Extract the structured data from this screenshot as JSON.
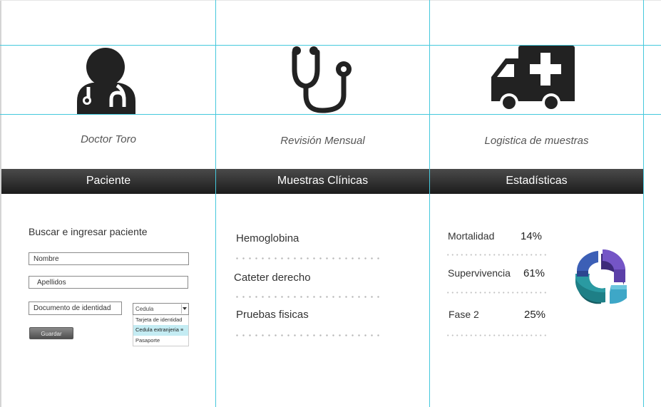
{
  "columns": [
    {
      "caption": "Doctor Toro",
      "header": "Paciente",
      "icon": "doctor-icon",
      "title": "Buscar e ingresar paciente",
      "fields": {
        "nombre_placeholder": "Nombre",
        "apellidos_placeholder": "Apellidos",
        "documento_placeholder": "Documento de identidad"
      },
      "document_type": {
        "selected": "Cedula",
        "options": [
          "Tarjeta de identidad",
          "Cedula extranjeria",
          "Pasaporte"
        ],
        "highlighted": "Cedula extranjeria"
      },
      "save_label": "Guardar"
    },
    {
      "caption": "Revisión Mensual",
      "header": "Muestras Clínicas",
      "icon": "stethoscope-icon",
      "items": [
        "Hemoglobina",
        "Cateter derecho",
        "Pruebas fisicas"
      ]
    },
    {
      "caption": "Logistica de muestras",
      "header": "Estadísticas",
      "icon": "ambulance-icon",
      "stats": [
        {
          "label": "Mortalidad",
          "value": "14%"
        },
        {
          "label": "Supervivencia",
          "value": "61%"
        },
        {
          "label": "Fase 2",
          "value": "25%"
        }
      ],
      "chart_icon": "donut-chart-icon"
    }
  ],
  "colors": {
    "guide": "#45c8dc",
    "header_bar": "#2a2a2a",
    "icon": "#222222",
    "chart": [
      "#5b3fa8",
      "#3ea7c7",
      "#1e7f86",
      "#3c5fb6"
    ]
  }
}
